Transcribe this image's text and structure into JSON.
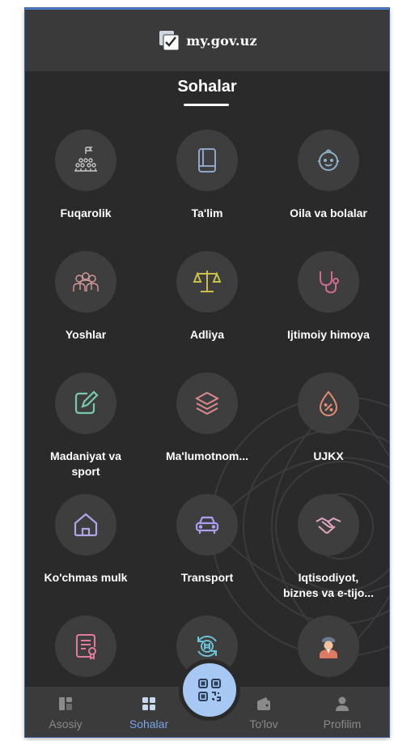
{
  "header": {
    "app_title": "my.gov.uz"
  },
  "page": {
    "title": "Sohalar"
  },
  "tiles": [
    {
      "label": "Fuqarolik",
      "icon": "citizens-flag-icon"
    },
    {
      "label": "Ta'lim",
      "icon": "book-icon"
    },
    {
      "label": "Oila va bolalar",
      "icon": "baby-face-icon"
    },
    {
      "label": "Yoshlar",
      "icon": "youth-group-icon"
    },
    {
      "label": "Adliya",
      "icon": "scales-icon"
    },
    {
      "label": "Ijtimoiy himoya",
      "icon": "stethoscope-icon"
    },
    {
      "label": "Madaniyat va\nsport",
      "icon": "edit-note-icon"
    },
    {
      "label": "Ma'lumotnom...",
      "icon": "layers-icon"
    },
    {
      "label": "UJKX",
      "icon": "water-drop-percent-icon"
    },
    {
      "label": "Ko'chmas mulk",
      "icon": "house-icon"
    },
    {
      "label": "Transport",
      "icon": "car-icon"
    },
    {
      "label": "Iqtisodiyot,\nbiznes va e-tijo...",
      "icon": "handshake-icon"
    },
    {
      "label": "",
      "icon": "certificate-icon"
    },
    {
      "label": "",
      "icon": "refresh-hash-icon"
    },
    {
      "label": "",
      "icon": "officer-icon"
    }
  ],
  "bottom_nav": [
    {
      "label": "Asosiy",
      "icon": "home-dashboard-icon"
    },
    {
      "label": "Sohalar",
      "icon": "grid-icon",
      "active": true
    },
    {
      "label": "To'lov",
      "icon": "wallet-icon"
    },
    {
      "label": "Profilim",
      "icon": "user-icon"
    }
  ],
  "colors": {
    "accent": "#7aa4e8",
    "qr_button": "#a6c8f2",
    "background": "#2a2a2a"
  }
}
